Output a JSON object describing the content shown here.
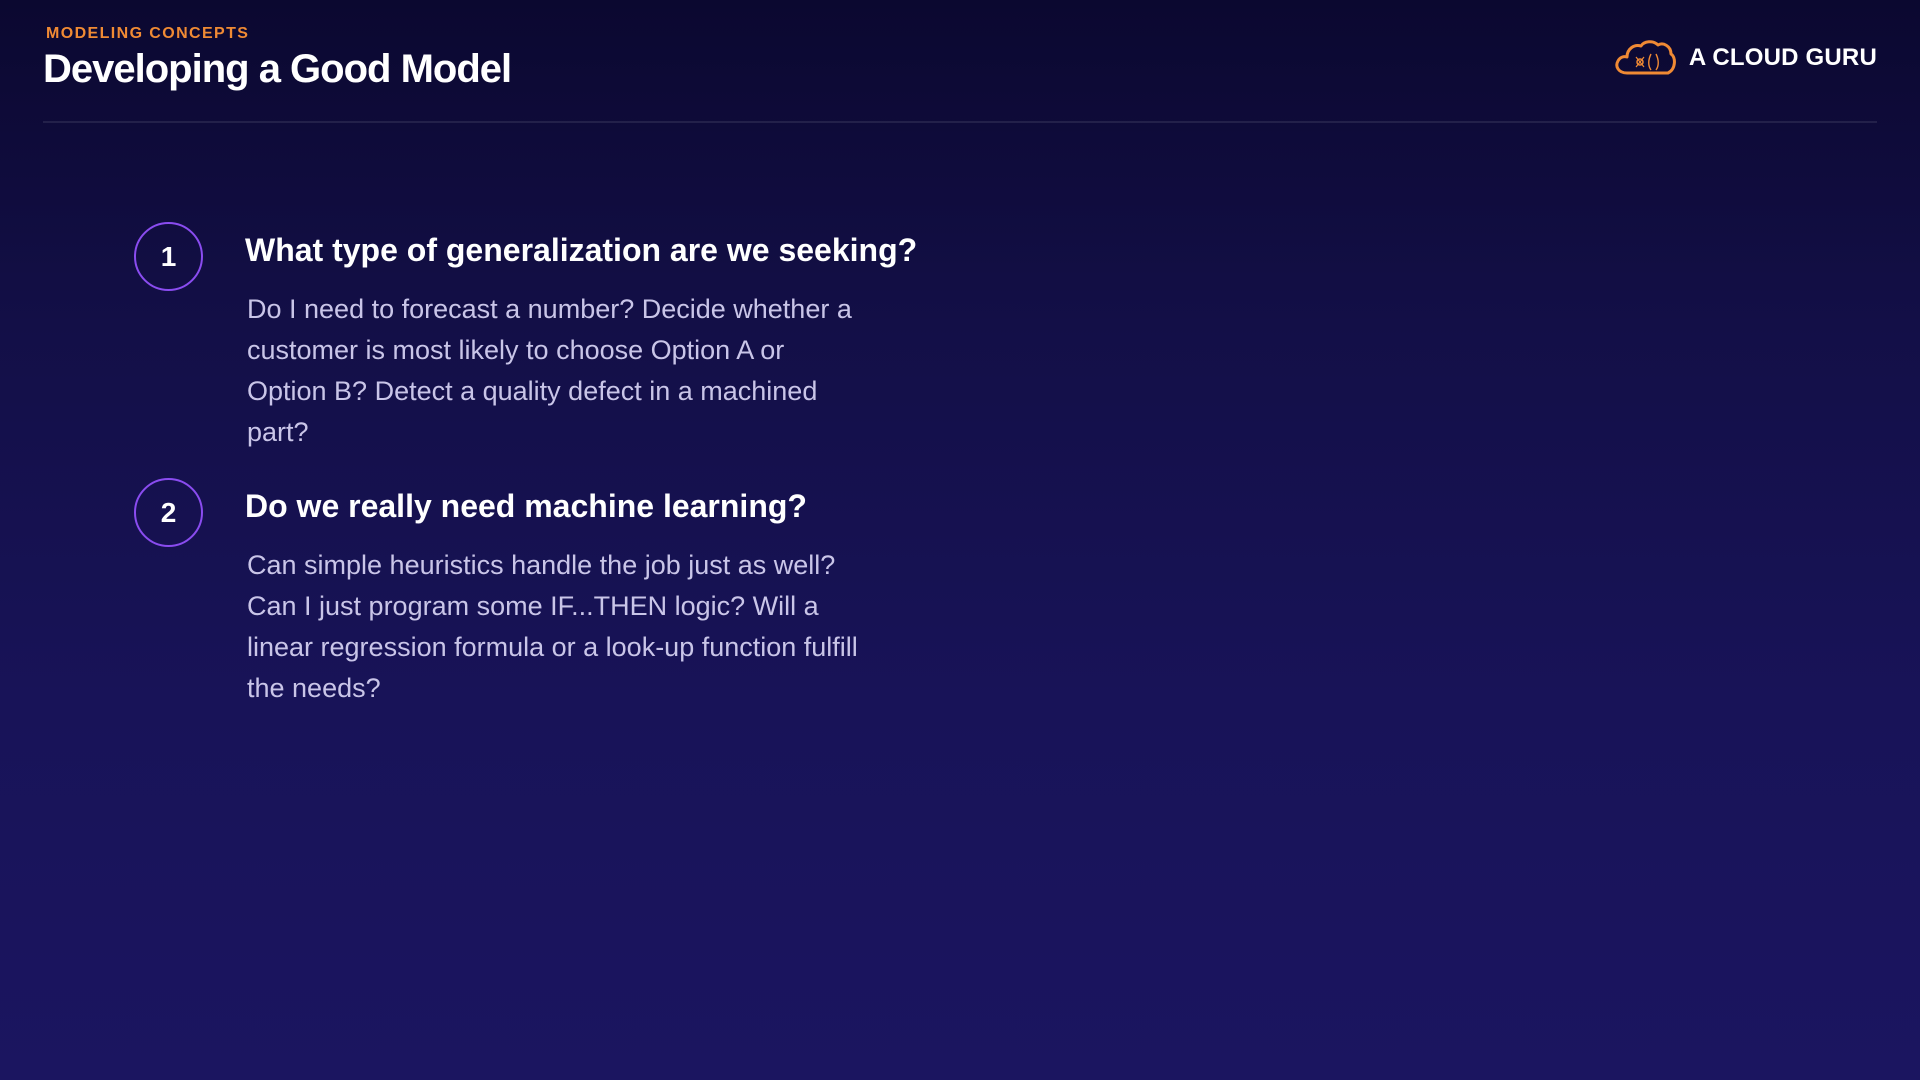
{
  "header": {
    "eyebrow": "MODELING CONCEPTS",
    "title": "Developing a Good Model",
    "brand": {
      "text": "A CLOUD GURU",
      "logo_icon": "cloud-logo-icon",
      "logo_color": "#f08a34"
    }
  },
  "items": [
    {
      "number": "1",
      "title": "What type of generalization are we seeking?",
      "body_lines": [
        "Do I need to forecast a number?  Decide whether a",
        "customer is most likely to choose Option A or",
        "Option B?  Detect a quality defect in a machined",
        "part?"
      ]
    },
    {
      "number": "2",
      "title": "Do we really need machine learning?",
      "body_lines": [
        "Can simple heuristics handle the job just as well?",
        "Can I just program some IF...THEN logic?  Will a",
        "linear regression formula or a look-up function fulfill",
        "the needs?"
      ]
    }
  ],
  "colors": {
    "accent_orange": "#f08a34",
    "accent_purple": "#8a4cf0",
    "background_top": "#0b0830",
    "background_bottom": "#1b1560",
    "body_text": "#c9c5e8"
  }
}
